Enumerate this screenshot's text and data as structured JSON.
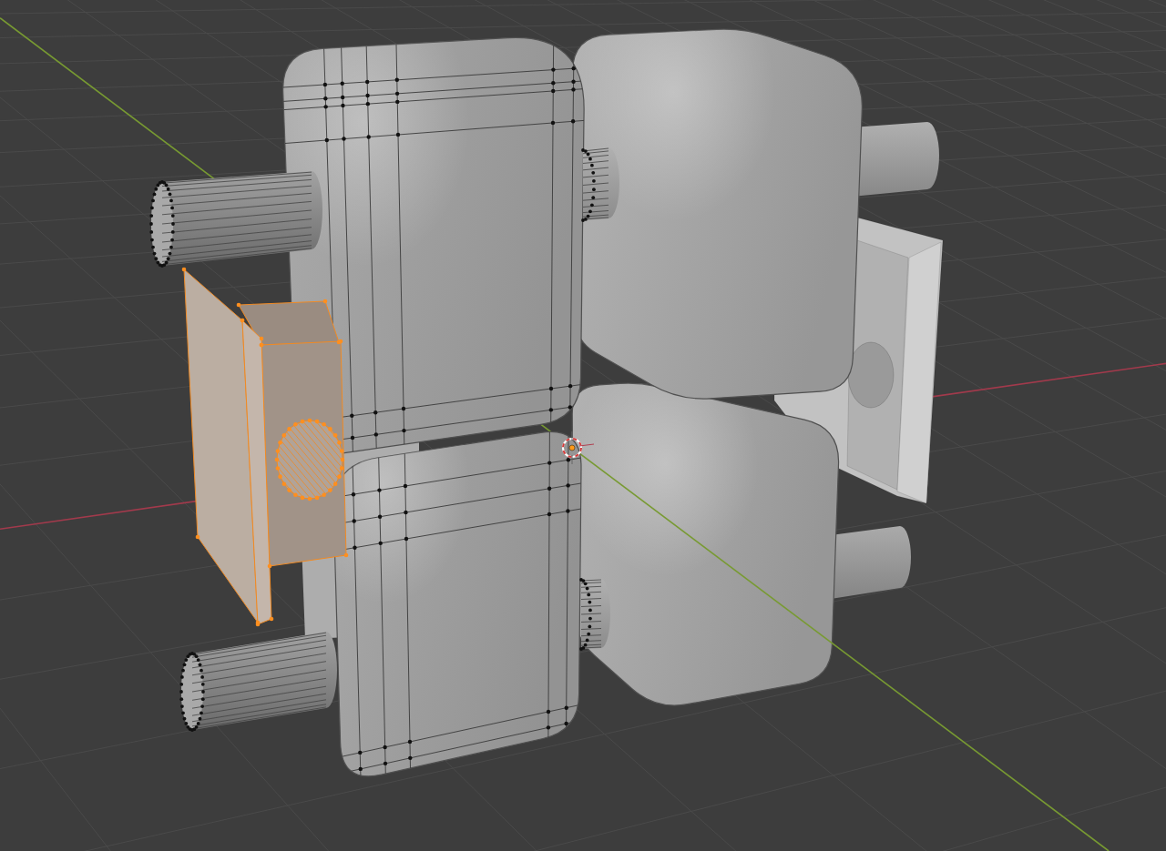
{
  "viewport": {
    "objects": [
      {
        "kind": "pin",
        "selected": false,
        "edit_mode": false
      },
      {
        "kind": "pin",
        "selected": false,
        "edit_mode": false
      },
      {
        "kind": "bracket",
        "selected": false,
        "edit_mode": false
      },
      {
        "kind": "box",
        "selected": false,
        "edit_mode": false
      },
      {
        "kind": "box",
        "selected": false,
        "edit_mode": false
      },
      {
        "kind": "block",
        "selected": false,
        "edit_mode": false
      },
      {
        "kind": "box",
        "selected": false,
        "edit_mode": true
      },
      {
        "kind": "box",
        "selected": false,
        "edit_mode": true
      },
      {
        "kind": "pin",
        "selected": false,
        "edit_mode": true
      },
      {
        "kind": "pin",
        "selected": false,
        "edit_mode": true
      },
      {
        "kind": "pin",
        "selected": false,
        "edit_mode": true
      },
      {
        "kind": "pin",
        "selected": false,
        "edit_mode": true
      },
      {
        "kind": "bracket",
        "selected": true,
        "edit_mode": true
      }
    ]
  }
}
